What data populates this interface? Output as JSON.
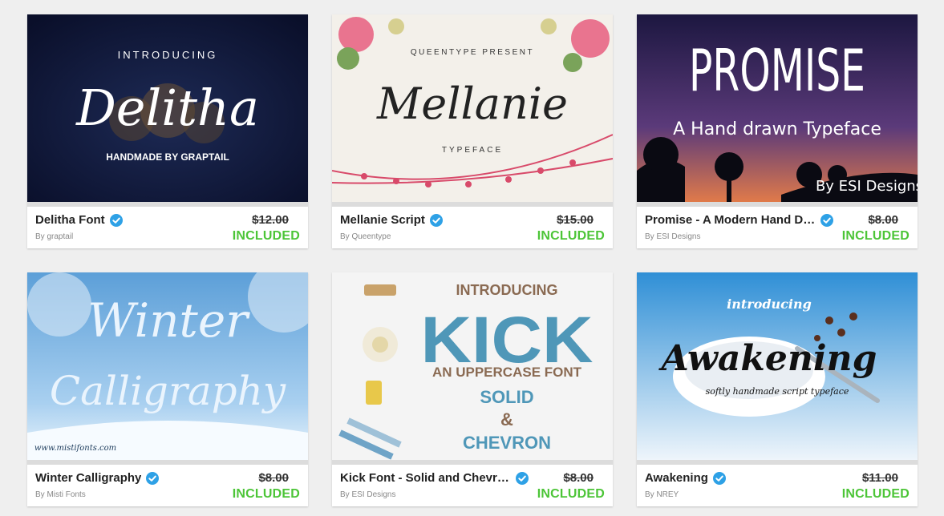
{
  "products": [
    {
      "title": "Delitha Font",
      "author": "By graptail",
      "old_price": "$12.00",
      "status": "INCLUDED",
      "preview": {
        "line1": "INTRODUCING",
        "main": "Delitha",
        "line2": "HANDMADE BY GRAPTAIL"
      }
    },
    {
      "title": "Mellanie Script",
      "author": "By Queentype",
      "old_price": "$15.00",
      "status": "INCLUDED",
      "preview": {
        "line1": "QUEENTYPE PRESENT",
        "main": "Mellanie",
        "line2": "TYPEFACE"
      }
    },
    {
      "title": "Promise - A Modern Hand Dr...",
      "author": "By ESI Designs",
      "old_price": "$8.00",
      "status": "INCLUDED",
      "preview": {
        "main": "PROMISE",
        "line1": "A Hand drawn Typeface",
        "line2": "By ESI Designs"
      }
    },
    {
      "title": "Winter Calligraphy",
      "author": "By Misti Fonts",
      "old_price": "$8.00",
      "status": "INCLUDED",
      "preview": {
        "main": "Winter",
        "main2": "Calligraphy",
        "line1": "www.mistifonts.com"
      }
    },
    {
      "title": "Kick Font - Solid and Chevron",
      "author": "By ESI Designs",
      "old_price": "$8.00",
      "status": "INCLUDED",
      "preview": {
        "line1": "INTRODUCING",
        "main": "KICK",
        "line2": "AN UPPERCASE FONT",
        "line3": "SOLID",
        "line4": "&",
        "line5": "CHEVRON"
      }
    },
    {
      "title": "Awakening",
      "author": "By NREY",
      "old_price": "$11.00",
      "status": "INCLUDED",
      "preview": {
        "line1": "introducing",
        "main": "Awakening",
        "line2": "softly handmade script typeface"
      }
    }
  ],
  "colors": {
    "included": "#4cc537",
    "verified": "#2ea1e6",
    "background": "#efefef"
  },
  "icons": {
    "verified": "verified-check-icon"
  }
}
